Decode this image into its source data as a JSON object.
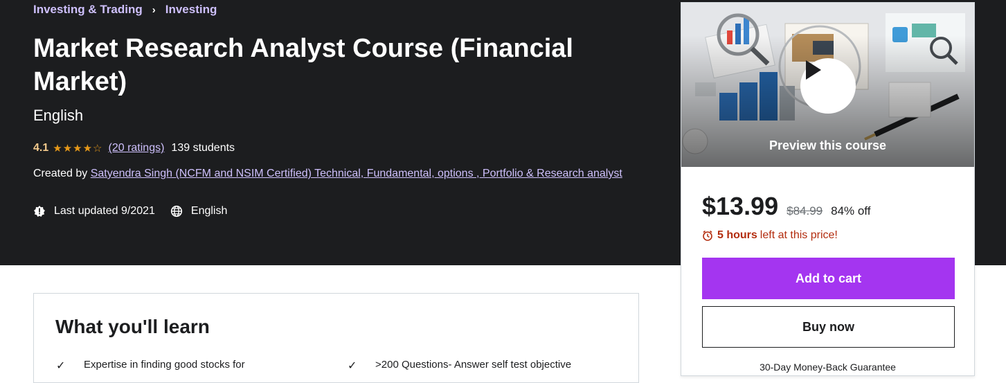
{
  "breadcrumb": {
    "items": [
      "Investing & Trading",
      "Investing"
    ],
    "separator": "›"
  },
  "course": {
    "title": "Market Research Analyst Course (Financial Market)",
    "subtitle": "English",
    "rating": "4.1",
    "stars": "★★★★☆",
    "ratings_count": "(20 ratings)",
    "students": "139 students",
    "created_by_label": "Created by",
    "author": "Satyendra Singh (NCFM and NSIM Certified) Technical, Fundamental, options , Portfolio & Research analyst",
    "last_updated": "Last updated 9/2021",
    "language": "English"
  },
  "purchase_card": {
    "preview_label": "Preview this course",
    "price": "$13.99",
    "original_price": "$84.99",
    "discount": "84% off",
    "timer_hours": "5 hours",
    "timer_suffix": "left at this price!",
    "add_to_cart": "Add to cart",
    "buy_now": "Buy now",
    "guarantee": "30-Day Money-Back Guarantee"
  },
  "learn": {
    "heading": "What you'll learn",
    "items": [
      "Expertise in finding good stocks for",
      ">200 Questions- Answer self test objective"
    ]
  },
  "colors": {
    "hero_bg": "#1c1d1f",
    "link": "#cec0fc",
    "accent": "#a435f0",
    "rating": "#e59819",
    "timer": "#b32d0f"
  },
  "icons": [
    "chevron-right-icon",
    "star-icon",
    "alert-icon",
    "globe-icon",
    "play-icon",
    "alarm-clock-icon",
    "check-icon"
  ]
}
